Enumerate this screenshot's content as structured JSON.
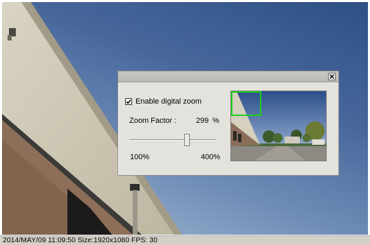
{
  "status_bar": {
    "text": "2014/MAY/09 11:09:50 Size:1920x1080 FPS: 30"
  },
  "zoom_dialog": {
    "close_icon": "close-icon",
    "enable_digital_zoom": {
      "label": "Enable digital zoom",
      "checked": true
    },
    "zoom_factor": {
      "label": "Zoom Factor :",
      "value": "299",
      "unit": "%",
      "fraction_of_range": 0.663
    },
    "slider": {
      "min_label": "100%",
      "max_label": "400%"
    },
    "preview": {
      "selection_color": "#19d219"
    }
  }
}
